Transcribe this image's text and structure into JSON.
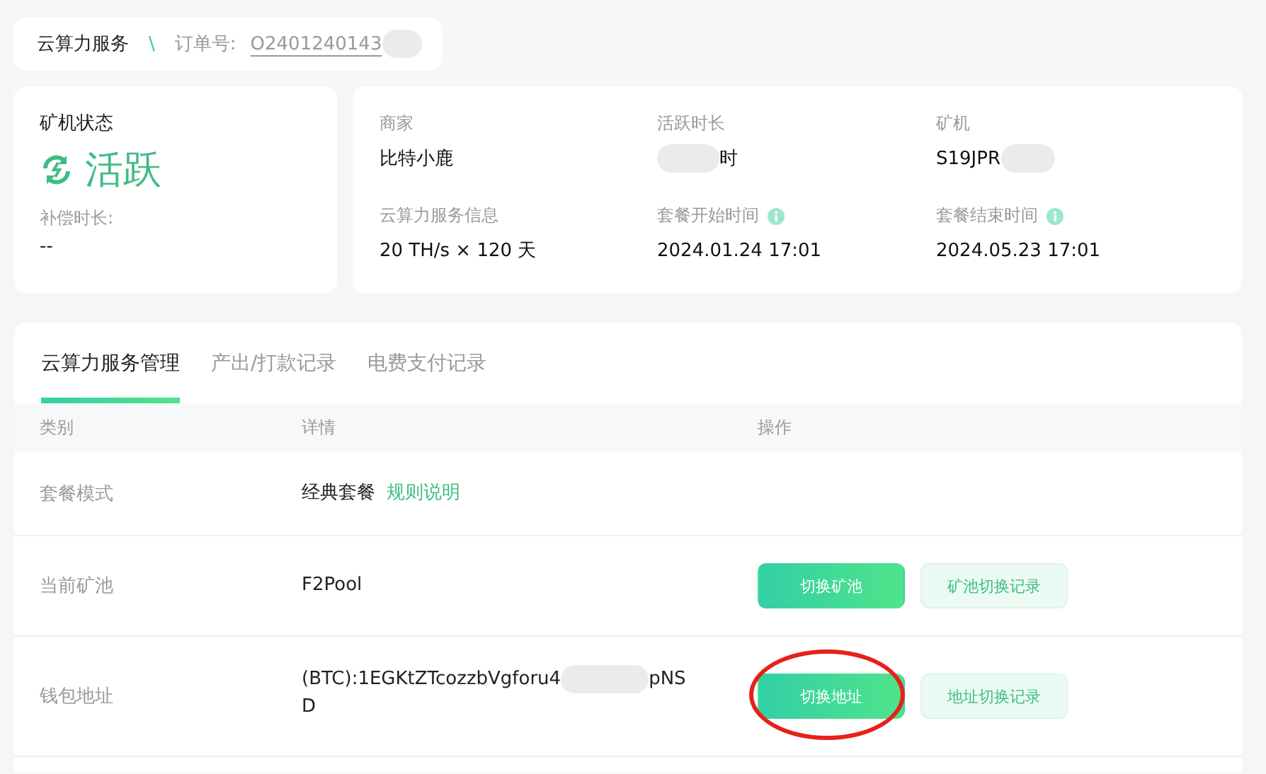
{
  "breadcrumb": {
    "title": "云算力服务",
    "separator": "\\",
    "order_label": "订单号:",
    "order_number": "O2401240143",
    "order_redacted": true
  },
  "status": {
    "label": "矿机状态",
    "value": "活跃",
    "comp_label": "补偿时长:",
    "comp_value": "--"
  },
  "info": [
    {
      "label": "商家",
      "value": "比特小鹿",
      "redacted": false,
      "hint": false
    },
    {
      "label": "活跃时长",
      "value": "时",
      "redacted": true,
      "hint": false
    },
    {
      "label": "矿机",
      "value": "S19JPR",
      "redacted": true,
      "hint": false
    },
    {
      "label": "云算力服务信息",
      "value": "20 TH/s × 120 天",
      "redacted": false,
      "hint": false
    },
    {
      "label": "套餐开始时间",
      "value": "2024.01.24 17:01",
      "redacted": false,
      "hint": true
    },
    {
      "label": "套餐结束时间",
      "value": "2024.05.23 17:01",
      "redacted": false,
      "hint": true
    }
  ],
  "tabs": [
    {
      "label": "云算力服务管理",
      "selected": true
    },
    {
      "label": "产出/打款记录",
      "selected": false
    },
    {
      "label": "电费支付记录",
      "selected": false
    }
  ],
  "table": {
    "columns": [
      "类别",
      "详情",
      "操作"
    ],
    "rows": [
      {
        "category": "套餐模式",
        "detail": "经典套餐",
        "link": "规则说明",
        "buttons": []
      },
      {
        "category": "当前矿池",
        "detail": "F2Pool",
        "buttons": [
          {
            "label": "切换矿池",
            "kind": "primary",
            "circled": false
          },
          {
            "label": "矿池切换记录",
            "kind": "secondary",
            "circled": false
          }
        ]
      },
      {
        "category": "钱包地址",
        "detail": "(BTC):1EGKtZTcozzbVgforu4",
        "detail_redacted": true,
        "detail_after": "pNS",
        "detail_second_line": "D",
        "buttons": [
          {
            "label": "切换地址",
            "kind": "primary",
            "circled": true
          },
          {
            "label": "地址切换记录",
            "kind": "secondary",
            "circled": false
          }
        ]
      }
    ]
  }
}
